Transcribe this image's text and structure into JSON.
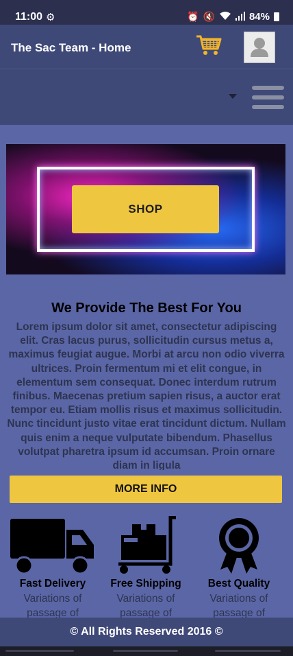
{
  "status_bar": {
    "time": "11:00",
    "battery": "84%"
  },
  "header": {
    "title": "The Sac Team - Home",
    "cart_icon": "shopping-cart-icon",
    "avatar_icon": "user-avatar-icon",
    "cart_color": "#f2b52a"
  },
  "nav": {
    "menu_icon": "hamburger-menu-icon"
  },
  "hero": {
    "button_label": "SHOP",
    "accent": "#efc640"
  },
  "section": {
    "title": "We Provide The Best For You",
    "body": "Lorem ipsum dolor sit amet, consectetur adipiscing elit. Cras lacus purus, sollicitudin cursus metus a, maximus feugiat augue. Morbi at arcu non odio viverra ultrices. Proin fermentum mi et elit congue, in elementum sem consequat. Donec interdum rutrum finibus. Maecenas pretium sapien risus, a auctor erat tempor eu. Etiam mollis risus et maximus sollicitudin. Nunc tincidunt justo vitae erat tincidunt dictum. Nullam quis enim a neque vulputate bibendum. Phasellus volutpat pharetra ipsum id accumsan. Proin ornare diam in ligula",
    "button_label": "MORE INFO"
  },
  "features": [
    {
      "title": "Fast Delivery",
      "description": "Variations of passage of",
      "icon": "delivery-truck-icon"
    },
    {
      "title": "Free Shipping",
      "description": "Variations of passage of",
      "icon": "hand-truck-boxes-icon"
    },
    {
      "title": "Best Quality",
      "description": "Variations of passage of",
      "icon": "award-ribbon-icon"
    }
  ],
  "footer": {
    "text": "© All Rights Reserved 2016 ©"
  }
}
